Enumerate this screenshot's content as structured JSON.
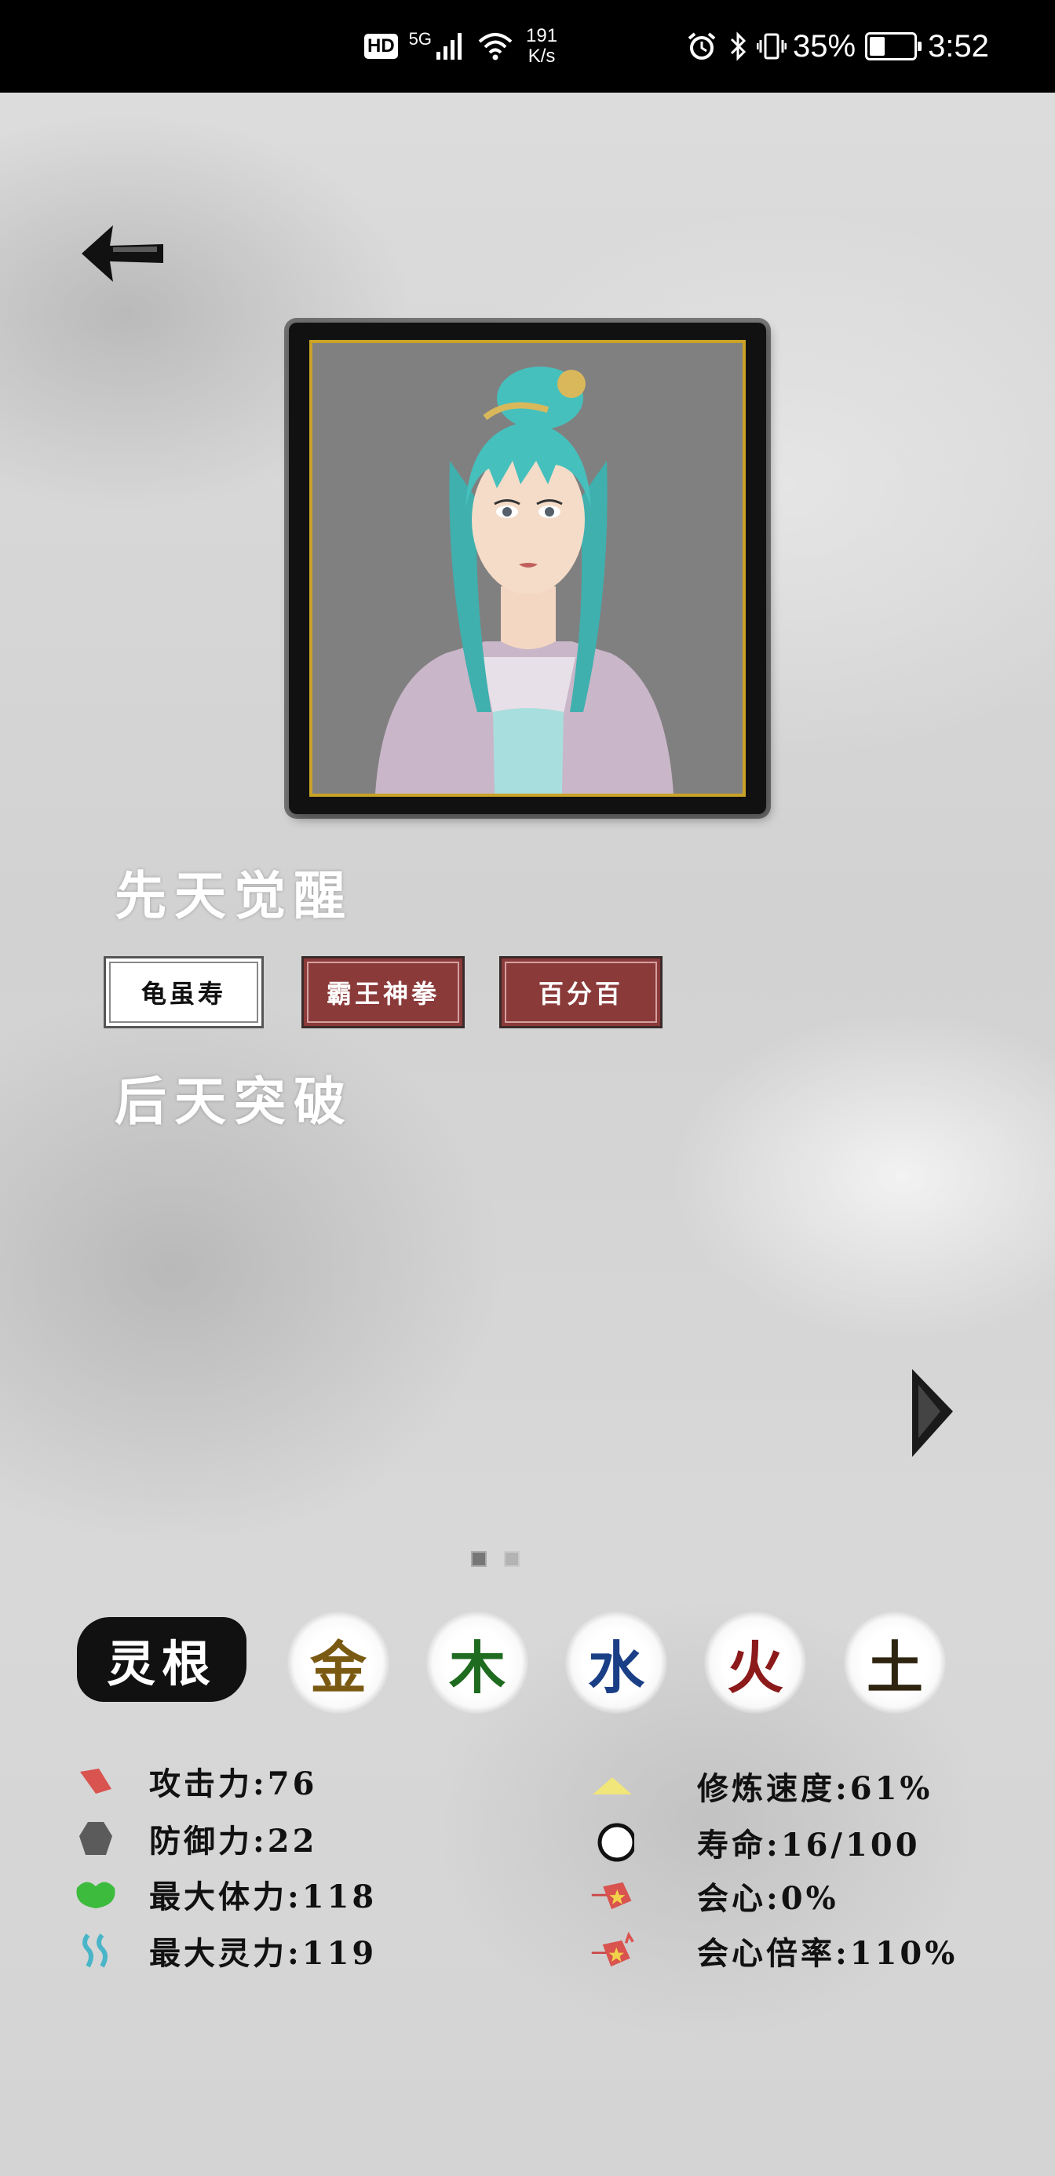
{
  "status_bar": {
    "hd": "HD",
    "network": "5G",
    "speed_value": "191",
    "speed_unit": "K/s",
    "battery_percent": "35%",
    "battery_level": 0.35,
    "time": "3:52"
  },
  "portrait": {
    "icon": "character-portrait"
  },
  "innate": {
    "title": "先天觉醒",
    "traits": [
      "龟虽寿",
      "霸王神拳",
      "百分百"
    ]
  },
  "acquired": {
    "title": "后天突破"
  },
  "pager": {
    "pages": 2,
    "current": 1
  },
  "spirit_root": {
    "title": "灵根",
    "elements": [
      {
        "char": "金",
        "color": "#7a5a12"
      },
      {
        "char": "木",
        "color": "#1f6b1f"
      },
      {
        "char": "水",
        "color": "#1a3f86"
      },
      {
        "char": "火",
        "color": "#8c1a1a"
      },
      {
        "char": "土",
        "color": "#2e2410"
      }
    ]
  },
  "stats_left": [
    {
      "label": "攻击力:76",
      "icon": "attack-icon",
      "color": "#d9534f"
    },
    {
      "label": "防御力:22",
      "icon": "defense-icon",
      "color": "#555555"
    },
    {
      "label": "最大体力:118",
      "icon": "stamina-icon",
      "color": "#3dbb3d"
    },
    {
      "label": "最大灵力:119",
      "icon": "spirit-power-icon",
      "color": "#4ab5c9"
    }
  ],
  "stats_right": [
    {
      "label": "修炼速度:61%",
      "icon": "cultivation-speed-icon",
      "color": "#f0e67a"
    },
    {
      "label": "寿命:16/100",
      "icon": "lifespan-icon",
      "color": "#111111"
    },
    {
      "label": "会心:0%",
      "icon": "critical-icon",
      "color": "#d9534f"
    },
    {
      "label": "会心倍率:110%",
      "icon": "critical-rate-icon",
      "color": "#d9534f"
    }
  ]
}
